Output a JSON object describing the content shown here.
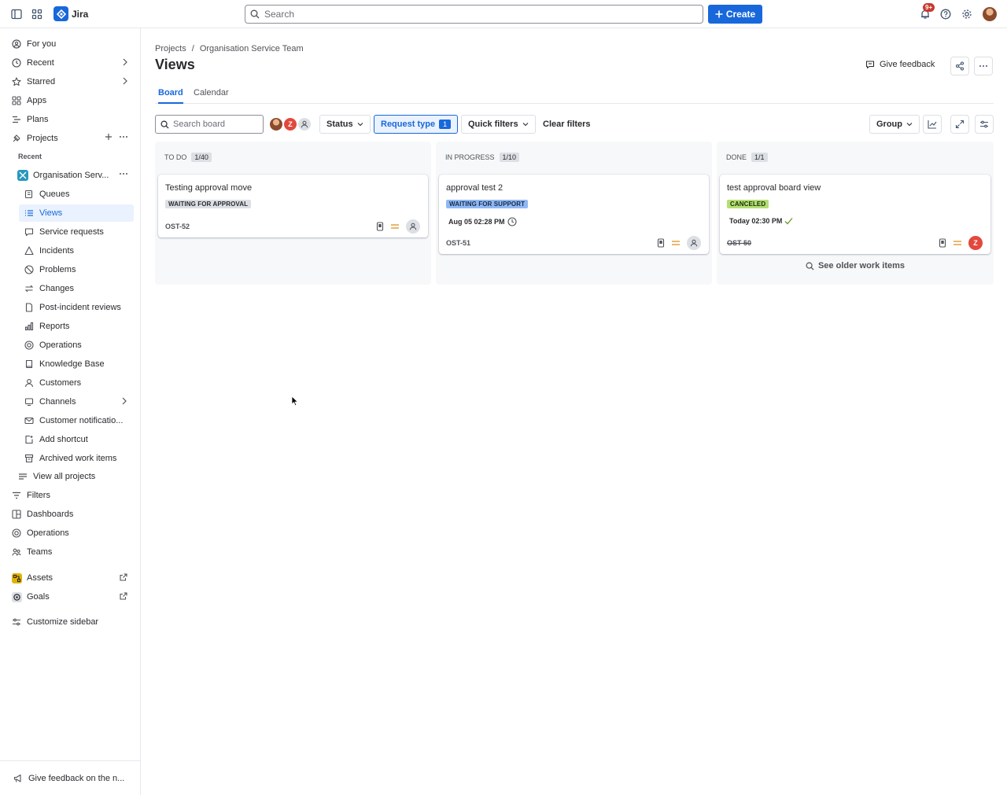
{
  "topbar": {
    "app_name": "Jira",
    "search_placeholder": "Search",
    "create_label": "Create",
    "notification_count": "9+"
  },
  "sidebar": {
    "items": [
      {
        "label": "For you",
        "icon": "for-you-icon"
      },
      {
        "label": "Recent",
        "icon": "clock-icon"
      },
      {
        "label": "Starred",
        "icon": "star-icon"
      },
      {
        "label": "Apps",
        "icon": "apps-icon"
      },
      {
        "label": "Plans",
        "icon": "plans-icon"
      },
      {
        "label": "Projects",
        "icon": "projects-icon"
      }
    ],
    "recent_header": "Recent",
    "project_name": "Organisation Serv...",
    "project_items": [
      {
        "label": "Queues",
        "icon": "queues-icon"
      },
      {
        "label": "Views",
        "icon": "views-icon"
      },
      {
        "label": "Service requests",
        "icon": "service-requests-icon"
      },
      {
        "label": "Incidents",
        "icon": "incidents-icon"
      },
      {
        "label": "Problems",
        "icon": "problems-icon"
      },
      {
        "label": "Changes",
        "icon": "changes-icon"
      },
      {
        "label": "Post-incident reviews",
        "icon": "post-incident-icon"
      },
      {
        "label": "Reports",
        "icon": "reports-icon"
      },
      {
        "label": "Operations",
        "icon": "operations-icon"
      },
      {
        "label": "Knowledge Base",
        "icon": "knowledge-base-icon"
      },
      {
        "label": "Customers",
        "icon": "customers-icon"
      },
      {
        "label": "Channels",
        "icon": "channels-icon"
      },
      {
        "label": "Customer notificatio...",
        "icon": "mail-icon"
      },
      {
        "label": "Add shortcut",
        "icon": "add-shortcut-icon"
      },
      {
        "label": "Archived work items",
        "icon": "archive-icon"
      }
    ],
    "view_all_projects": "View all projects",
    "bottom_items": [
      {
        "label": "Filters",
        "icon": "filter-icon"
      },
      {
        "label": "Dashboards",
        "icon": "dashboard-icon"
      },
      {
        "label": "Operations",
        "icon": "operations-icon"
      },
      {
        "label": "Teams",
        "icon": "teams-icon"
      },
      {
        "label": "Assets",
        "icon": "assets-icon"
      },
      {
        "label": "Goals",
        "icon": "goals-icon"
      }
    ],
    "customize": "Customize sidebar",
    "footer_feedback": "Give feedback on the n..."
  },
  "header": {
    "breadcrumb": [
      "Projects",
      "/",
      "Organisation Service Team"
    ],
    "title": "Views",
    "give_feedback": "Give feedback"
  },
  "tabs": [
    "Board",
    "Calendar"
  ],
  "toolbar": {
    "search_placeholder": "Search board",
    "status_label": "Status",
    "request_type_label": "Request type",
    "request_type_count": "1",
    "quick_filters_label": "Quick filters",
    "clear_filters_label": "Clear filters",
    "group_label": "Group",
    "avatar_initial": "Z"
  },
  "columns": [
    {
      "name": "TO DO",
      "count": "1/40",
      "cards": [
        {
          "title": "Testing approval move",
          "status": "WAITING FOR APPROVAL",
          "key": "OST-52"
        }
      ]
    },
    {
      "name": "IN PROGRESS",
      "count": "1/10",
      "cards": [
        {
          "title": "approval test 2",
          "status": "WAITING FOR SUPPORT",
          "date": "Aug 05 02:28 PM",
          "key": "OST-51"
        }
      ]
    },
    {
      "name": "DONE",
      "count": "1/1",
      "cards": [
        {
          "title": "test approval board view",
          "status": "CANCELED",
          "date": "Today 02:30 PM",
          "key": "OST-50",
          "assignee_initial": "Z"
        }
      ],
      "older_label": "See older work items"
    }
  ],
  "colors": {
    "brand": "#1868db",
    "waiting_approval_bg": "#dcdfe4",
    "waiting_support_bg": "#8fb8f6",
    "canceled_bg": "#b3df72",
    "priority_medium": "#e2a03f",
    "avatar_red": "#e2483d"
  }
}
